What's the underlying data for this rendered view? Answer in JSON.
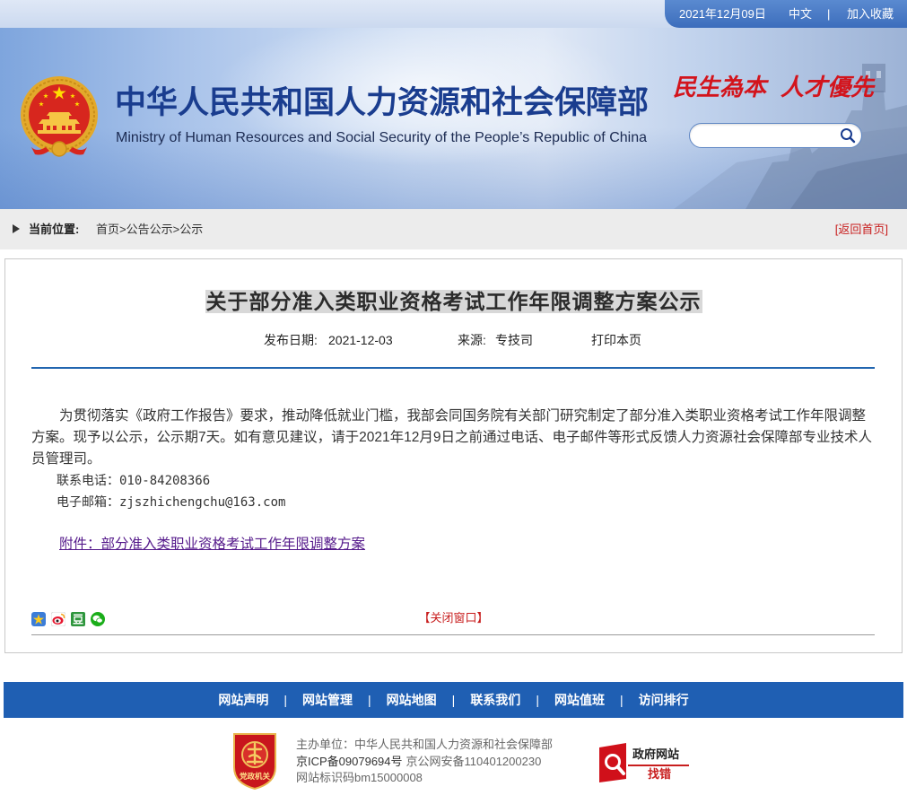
{
  "colors": {
    "nav_blue": "#1f5fb3",
    "title_blue": "#1a3d8f",
    "accent_red": "#c81e1e",
    "link_purple": "#551a8b",
    "rule_blue": "#2266b0",
    "slogan_red": "#d3141c"
  },
  "topbar": {
    "date": "2021年12月09日",
    "language": "中文",
    "separator": "|",
    "favorite": "加入收藏"
  },
  "header": {
    "title_cn": "中华人民共和国人力资源和社会保障部",
    "title_en": "Ministry of Human Resources and Social Security of the People’s Republic of China",
    "slogan": [
      "民生為本",
      "人才優先"
    ],
    "search": {
      "value": "",
      "placeholder": ""
    },
    "icons": {
      "logo": "national-emblem-icon",
      "search": "search-icon"
    }
  },
  "breadcrumb": {
    "label": "当前位置:",
    "crumbs": [
      "首页",
      "公告公示",
      "公示"
    ],
    "separator": ">",
    "back_home": "[返回首页]"
  },
  "article": {
    "title": "关于部分准入类职业资格考试工作年限调整方案公示",
    "meta": {
      "date_label": "发布日期:",
      "date": "2021-12-03",
      "source_label": "来源:",
      "source": "专技司",
      "print": "打印本页"
    },
    "paragraphs": [
      "为贯彻落实《政府工作报告》要求，推动降低就业门槛，我部会同国务院有关部门研究制定了部分准入类职业资格考试工作年限调整方案。现予以公示，公示期7天。如有意见建议，请于2021年12月9日之前通过电话、电子邮件等形式反馈人力资源社会保障部专业技术人员管理司。"
    ],
    "contact": {
      "phone": "联系电话：010-84208366",
      "email": "电子邮箱：zjszhichengchu@163.com"
    },
    "attachment": "附件：部分准入类职业资格考试工作年限调整方案",
    "share_icons": [
      "qzone-icon",
      "weibo-icon",
      "douban-icon",
      "wechat-icon"
    ],
    "close": "【关闭窗口】"
  },
  "footer": {
    "nav": [
      "网站声明",
      "网站管理",
      "网站地图",
      "联系我们",
      "网站值班",
      "访问排行"
    ],
    "separator": "|",
    "badge": "党政机关",
    "host": "主办单位：中华人民共和国人力资源和社会保障部",
    "icp": "京ICP备09079694号",
    "police": "京公网安备110401200230",
    "site_code": "网站标识码bm15000008",
    "report_error": {
      "line1": "政府网站",
      "line2": "找错"
    }
  }
}
